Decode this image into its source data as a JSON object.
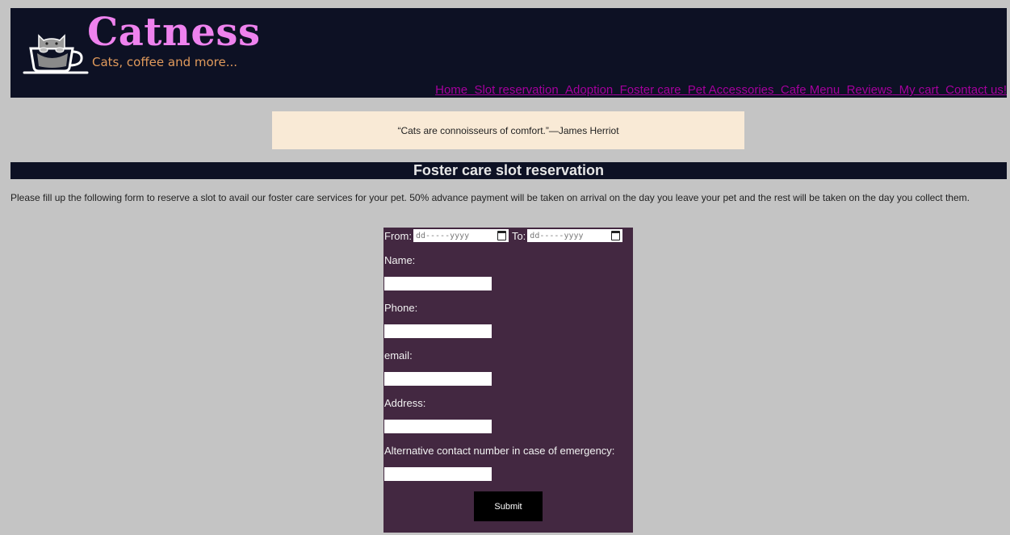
{
  "brand": {
    "name": "Catness",
    "tagline": "Cats, coffee and more...",
    "logo_icon": "cat-in-coffee-cup-icon"
  },
  "nav": {
    "items": [
      "Home",
      "Slot reservation",
      "Adoption",
      "Foster care",
      "Pet Accessories",
      "Cafe Menu",
      "Reviews",
      "My cart",
      "Contact us!"
    ]
  },
  "quote": "“Cats are connoisseurs of comfort.”—James Herriot",
  "page_title": "Foster care slot reservation",
  "intro": "Please fill up the following form to reserve a slot to avail our foster care services for your pet. 50% advance payment will be taken on arrival on the day you leave your pet and the rest will be taken on the day you collect them.",
  "form": {
    "from_label": "From:",
    "to_label": "To:",
    "date_placeholder": "dd-----yyyy",
    "fields": [
      {
        "label": "Name:",
        "value": ""
      },
      {
        "label": "Phone:",
        "value": ""
      },
      {
        "label": "email:",
        "value": ""
      },
      {
        "label": "Address:",
        "value": ""
      },
      {
        "label": "Alternative contact number in case of emergency:",
        "value": ""
      }
    ],
    "submit_label": "Submit"
  },
  "colors": {
    "background": "#c4c4c4",
    "header_bg": "#0d1124",
    "brand": "#ee82ee",
    "tagline": "#e09a5c",
    "nav_link": "#a4009c",
    "quote_bg": "#f9ead6",
    "form_bg": "#432841"
  }
}
